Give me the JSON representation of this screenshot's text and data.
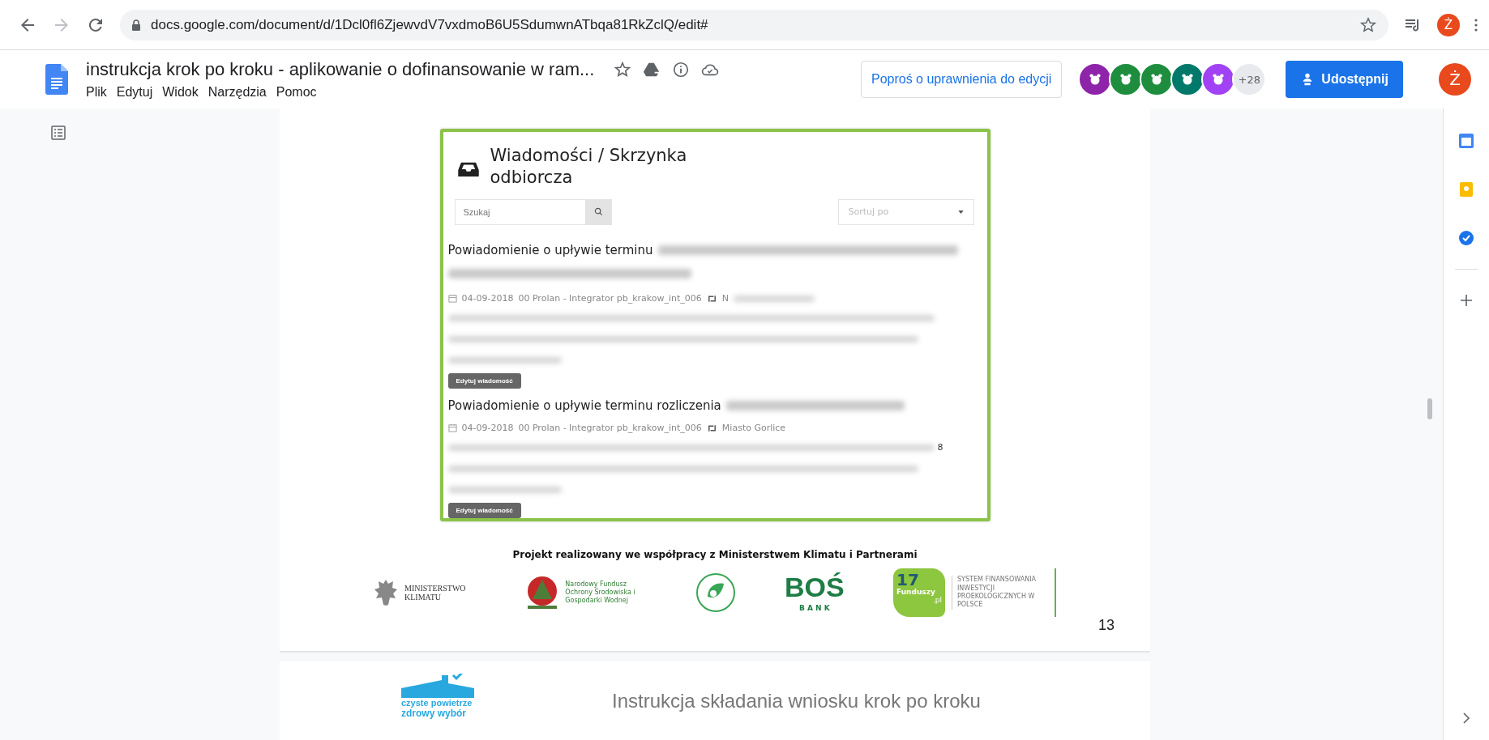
{
  "browser": {
    "url": "docs.google.com/document/d/1Dcl0fl6ZjewvdV7vxdmoB6U5SdumwnATbqa81RkZclQ/edit#",
    "profile_initial": "Ż"
  },
  "document": {
    "title": "instrukcja krok po kroku - aplikowanie o dofinansowanie w ram...",
    "menu": [
      "Plik",
      "Edytuj",
      "Widok",
      "Narzędzia",
      "Pomoc"
    ],
    "request_edit": "Poproś o uprawnienia do edycji",
    "collaborators": [
      {
        "color": "#8e24aa"
      },
      {
        "color": "#1e8e3e"
      },
      {
        "color": "#1e8e3e"
      },
      {
        "color": "#00796b"
      },
      {
        "color": "#a142f4"
      }
    ],
    "more_collaborators": "+28",
    "share": "Udostępnij",
    "account_initial": "Ż"
  },
  "page": {
    "inbox": {
      "title": "Wiadomości / Skrzynka odbiorcza",
      "search_placeholder": "Szukaj",
      "sort_placeholder": "Sortuj po",
      "messages": [
        {
          "subject": "Powiadomienie o upływie terminu",
          "date": "04-09-2018",
          "meta": "00 Prolan - Integrator pb_krakow_int_006",
          "recipient": "N",
          "button": "Edytuj wiadomość"
        },
        {
          "subject": "Powiadomienie o upływie terminu rozliczenia",
          "date": "04-09-2018",
          "meta": "00 Prolan - Integrator pb_krakow_int_006",
          "recipient": "Miasto Gorlice",
          "trailing": "8",
          "button": "Edytuj wiadomość"
        }
      ]
    },
    "footer": {
      "caption": "Projekt realizowany we współpracy z Ministerstwem Klimatu i Partnerami",
      "ministry": "MINISTERSTWO KLIMATU",
      "fund": "Narodowy Fundusz Ochrony Środowiska i Gospodarki Wodnej",
      "bank": "BOŚ",
      "bank_sub": "B A N K",
      "funduszy_num": "17",
      "funduszy": "Funduszy",
      "funduszy_tld": ".pl",
      "system": "SYSTEM FINANSOWANIA INWESTYCJI PROEKOLOGICZNYCH W POLSCE"
    },
    "page_number": "13"
  },
  "next_page": {
    "logo_line1": "czyste powietrze",
    "logo_line2": "zdrowy wybór",
    "header": "Instrukcja składania wniosku krok po kroku"
  }
}
